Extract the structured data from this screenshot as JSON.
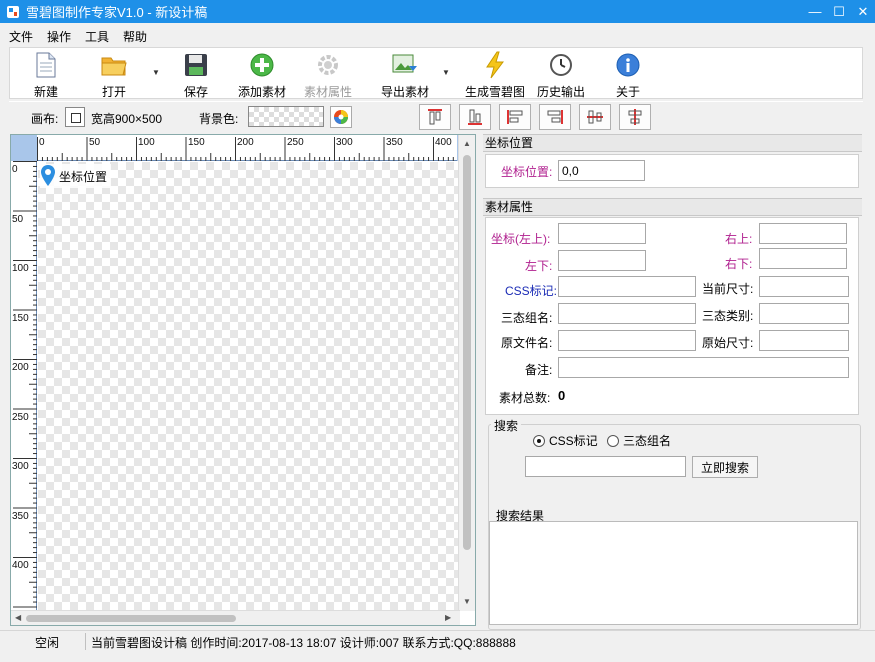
{
  "window": {
    "title": "雪碧图制作专家V1.0 - 新设计稿",
    "minimize": "—",
    "maximize": "☐",
    "close": "✕"
  },
  "menu": [
    "文件",
    "操作",
    "工具",
    "帮助"
  ],
  "toolbar": {
    "new": "新建",
    "open": "打开",
    "save": "保存",
    "add_asset": "添加素材",
    "asset_props": "素材属性",
    "export_asset": "导出素材",
    "generate": "生成雪碧图",
    "history": "历史输出",
    "about": "关于"
  },
  "options": {
    "canvas_label": "画布:",
    "canvas_size": "宽高900×500",
    "bg_label": "背景色:"
  },
  "ruler": {
    "top": [
      "0",
      "50",
      "100",
      "150",
      "200",
      "250",
      "300",
      "350",
      "400"
    ],
    "left": [
      "0",
      "50",
      "100",
      "150",
      "200",
      "250",
      "300",
      "350",
      "400"
    ]
  },
  "editor": {
    "marker_label": "坐标位置"
  },
  "coord_section": {
    "title": "坐标位置",
    "label": "坐标位置:",
    "value": "0,0"
  },
  "asset_section": {
    "title": "素材属性",
    "top_left": "坐标(左上):",
    "top_right": "右上:",
    "bottom_left": "左下:",
    "bottom_right": "右下:",
    "css_tag": "CSS标记:",
    "current_size": "当前尺寸:",
    "tri_group": "三态组名:",
    "tri_type": "三态类别:",
    "orig_file": "原文件名:",
    "orig_size": "原始尺寸:",
    "note": "备注:",
    "total_label": "素材总数:",
    "total_value": "0"
  },
  "search": {
    "title": "搜索",
    "opt_css": "CSS标记",
    "opt_tri": "三态组名",
    "button": "立即搜索",
    "results_title": "搜索结果"
  },
  "status": {
    "state": "空闲",
    "info": "当前雪碧图设计稿 创作时间:2017-08-13 18:07 设计师:007 联系方式:QQ:888888"
  },
  "colors": {
    "titlebar": "#1e90e8",
    "ruler": "#a9c6ea",
    "label_pink": "#b0208f",
    "label_blue": "#1a2bb5"
  }
}
